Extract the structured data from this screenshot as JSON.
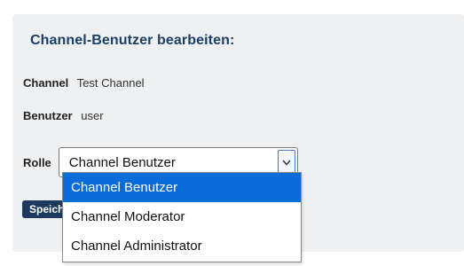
{
  "form": {
    "title": "Channel-Benutzer bearbeiten:",
    "channel_label": "Channel",
    "channel_value": "Test Channel",
    "user_label": "Benutzer",
    "user_value": "user",
    "role_label": "Rolle",
    "role_selected": "Channel Benutzer",
    "role_options": [
      {
        "label": "Channel Benutzer",
        "selected": true
      },
      {
        "label": "Channel Moderator",
        "selected": false
      },
      {
        "label": "Channel Administrator",
        "selected": false
      }
    ],
    "save_label": "Speichern"
  },
  "colors": {
    "title": "#1c3f66",
    "panel_bg": "#eef0f2",
    "button_bg": "#1d3a5e",
    "option_highlight": "#0a6cd9",
    "select_arrow_border": "#4a79c4"
  },
  "icons": {
    "select_arrow": "chevron-down-icon"
  }
}
